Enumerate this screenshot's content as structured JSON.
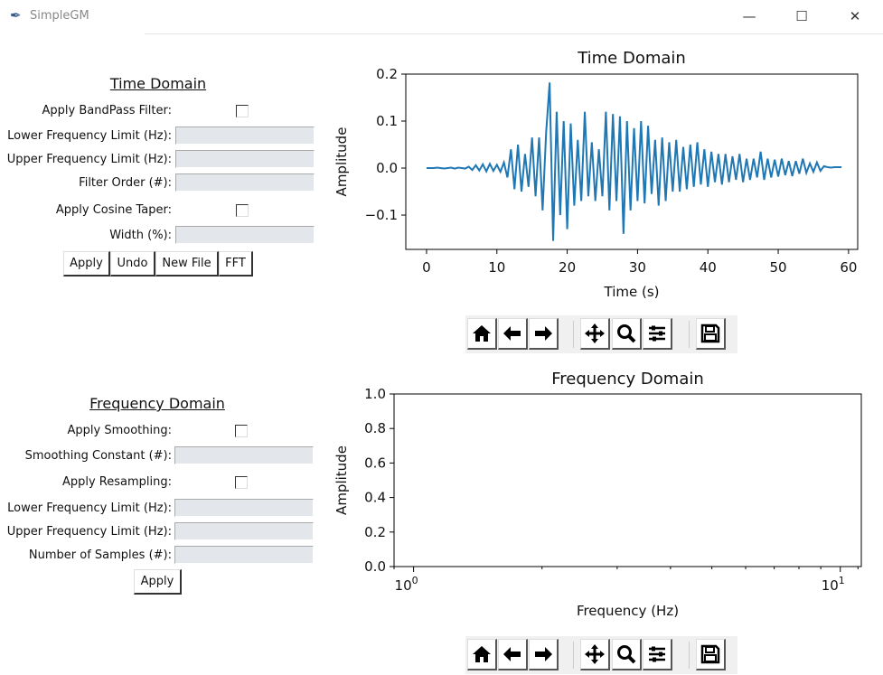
{
  "window": {
    "title": "SimpleGM",
    "minimize": "—",
    "maximize": "☐",
    "close": "✕"
  },
  "time_panel": {
    "header": "Time Domain",
    "bandpass_label": "Apply BandPass Filter:",
    "bandpass_checked": false,
    "lower_label": "Lower Frequency Limit (Hz):",
    "lower_value": "",
    "upper_label": "Upper Frequency Limit (Hz):",
    "upper_value": "",
    "order_label": "Filter Order (#):",
    "order_value": "",
    "taper_label": "Apply Cosine Taper:",
    "taper_checked": false,
    "width_label": "Width (%):",
    "width_value": "",
    "buttons": {
      "apply": "Apply",
      "undo": "Undo",
      "new_file": "New File",
      "fft": "FFT"
    }
  },
  "freq_panel": {
    "header": "Frequency Domain",
    "smoothing_label": "Apply Smoothing:",
    "smoothing_checked": false,
    "smoothing_const_label": "Smoothing Constant (#):",
    "smoothing_const_value": "",
    "resampling_label": "Apply Resampling:",
    "resampling_checked": false,
    "lower_label": "Lower Frequency Limit (Hz):",
    "lower_value": "",
    "upper_label": "Upper Frequency Limit (Hz):",
    "upper_value": "",
    "samples_label": "Number of Samples (#):",
    "samples_value": "",
    "apply": "Apply"
  },
  "toolbar_icons": [
    "home-icon",
    "back-arrow-icon",
    "forward-arrow-icon",
    "pan-icon",
    "zoom-icon",
    "configure-subplots-icon",
    "save-icon"
  ],
  "chart_data": [
    {
      "type": "line",
      "title": "Time Domain",
      "xlabel": "Time (s)",
      "ylabel": "Amplitude",
      "color": "#1f77b4",
      "xlim": [
        -2.95,
        61.3
      ],
      "ylim": [
        -0.173,
        0.2
      ],
      "xticks": [
        "0",
        "10",
        "20",
        "30",
        "40",
        "50",
        "60"
      ],
      "xtick_values": [
        0,
        10,
        20,
        30,
        40,
        50,
        60
      ],
      "yticks": [
        "0.2",
        "0.1",
        "0.0",
        "−0.1"
      ],
      "ytick_values": [
        0.2,
        0.1,
        0.0,
        -0.1
      ],
      "x": [
        0,
        0.5,
        1,
        1.5,
        2,
        2.5,
        3,
        3.5,
        4,
        4.5,
        5,
        5.5,
        6,
        6.5,
        7,
        7.5,
        8,
        8.5,
        9,
        9.5,
        10,
        10.5,
        11,
        11.5,
        12,
        12.5,
        13,
        13.5,
        14,
        14.5,
        15,
        15.5,
        16,
        16.5,
        17,
        17.5,
        18,
        18.5,
        19,
        19.5,
        20,
        20.5,
        21,
        21.5,
        22,
        22.5,
        23,
        23.5,
        24,
        24.5,
        25,
        25.5,
        26,
        26.5,
        27,
        27.5,
        28,
        28.5,
        29,
        29.5,
        30,
        30.5,
        31,
        31.5,
        32,
        32.5,
        33,
        33.5,
        34,
        34.5,
        35,
        35.5,
        36,
        36.5,
        37,
        37.5,
        38,
        38.5,
        39,
        39.5,
        40,
        40.5,
        41,
        41.5,
        42,
        42.5,
        43,
        43.5,
        44,
        44.5,
        45,
        45.5,
        46,
        46.5,
        47,
        47.5,
        48,
        48.5,
        49,
        49.5,
        50,
        50.5,
        51,
        51.5,
        52,
        52.5,
        53,
        53.5,
        54,
        54.5,
        55,
        55.5,
        56,
        56.5,
        57,
        57.5,
        58,
        58.5,
        59
      ],
      "y": [
        0,
        0,
        0,
        0.001,
        0,
        -0.001,
        0,
        0.001,
        -0.001,
        0.001,
        0,
        -0.001,
        0.003,
        -0.004,
        0.006,
        -0.005,
        0.008,
        -0.007,
        0.009,
        -0.006,
        0.007,
        -0.008,
        0.012,
        -0.02,
        0.04,
        -0.045,
        0.05,
        -0.05,
        0.03,
        -0.04,
        0.065,
        -0.06,
        0.065,
        -0.09,
        0.075,
        0.182,
        -0.155,
        0.12,
        -0.1,
        0.1,
        -0.13,
        0.095,
        -0.08,
        0.06,
        -0.07,
        0.12,
        -0.06,
        0.055,
        -0.07,
        0.04,
        -0.06,
        0.12,
        -0.09,
        0.115,
        -0.07,
        0.11,
        -0.14,
        0.1,
        -0.09,
        0.085,
        -0.07,
        0.1,
        -0.075,
        0.09,
        -0.055,
        0.06,
        -0.08,
        0.065,
        -0.07,
        0.055,
        -0.05,
        0.06,
        -0.05,
        0.045,
        -0.045,
        0.05,
        -0.04,
        0.055,
        -0.035,
        0.04,
        -0.04,
        0.035,
        -0.03,
        0.03,
        -0.035,
        0.03,
        -0.03,
        0.025,
        -0.025,
        0.03,
        -0.03,
        0.02,
        -0.025,
        0.02,
        -0.02,
        0.035,
        -0.025,
        0.02,
        -0.02,
        0.018,
        -0.018,
        0.02,
        -0.015,
        0.015,
        -0.017,
        0.015,
        -0.012,
        0.02,
        -0.01,
        0.01,
        -0.008,
        0.012,
        -0.006,
        0.004,
        0.002,
        0.001,
        0.002,
        0.002,
        0.002
      ]
    },
    {
      "type": "line",
      "title": "Frequency Domain",
      "xlabel": "Frequency (Hz)",
      "ylabel": "Amplitude",
      "xscale": "log",
      "xlim": [
        0.9,
        11.2
      ],
      "ylim": [
        0,
        1
      ],
      "xticks": [
        {
          "base": "10",
          "exp": "0",
          "value": 1
        },
        {
          "base": "10",
          "exp": "1",
          "value": 10
        }
      ],
      "yticks": [
        "1.0",
        "0.8",
        "0.6",
        "0.4",
        "0.2",
        "0.0"
      ],
      "ytick_values": [
        1,
        0.8,
        0.6,
        0.4,
        0.2,
        0
      ],
      "series": []
    }
  ]
}
